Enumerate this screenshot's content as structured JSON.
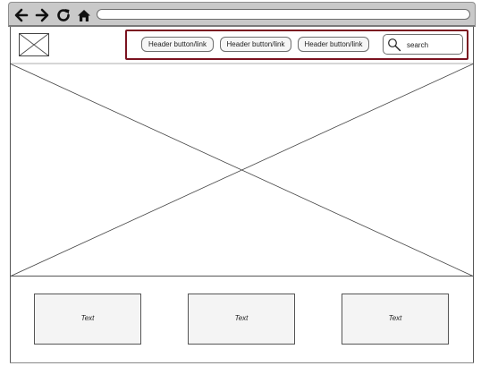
{
  "browser": {
    "url": "",
    "nav_icons": [
      "back-arrow-icon",
      "forward-arrow-icon",
      "reload-icon",
      "home-icon"
    ]
  },
  "header": {
    "logo_icon": "image-placeholder-icon",
    "buttons": [
      {
        "label": "Header button/link"
      },
      {
        "label": "Header button/link"
      },
      {
        "label": "Header button/link"
      }
    ],
    "search": {
      "icon": "search-icon",
      "placeholder": "search"
    },
    "highlight_color": "#7b1220"
  },
  "hero": {
    "icon": "image-placeholder-icon"
  },
  "cards": [
    {
      "text": "Text"
    },
    {
      "text": "Text"
    },
    {
      "text": "Text"
    }
  ]
}
